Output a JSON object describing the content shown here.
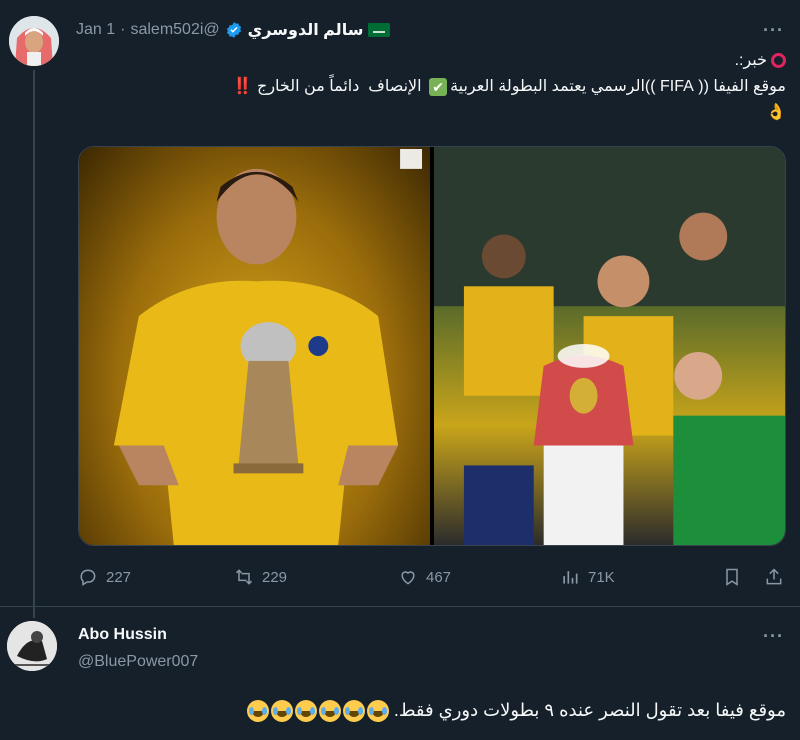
{
  "tweet": {
    "author_name": "سالم الدوسري",
    "handle": "@salem502i",
    "separator": "·",
    "date": "Jan 1",
    "more_label": "···",
    "text_line1": "خبر:.",
    "text_line2": "موقع الفيفا (( FIFA ))الرسمي يعتمد البطولة العربية",
    "text_line2_tail": " الإنصاف  دائماً من الخارج ",
    "bang": "‼️",
    "ok_hand": "👌",
    "media_alt": [
      "",
      ""
    ],
    "stats": {
      "replies": "227",
      "retweets": "229",
      "likes": "467",
      "views": "71K"
    }
  },
  "reply": {
    "author_name": "Abo Hussin",
    "handle": "@BluePower007",
    "more_label": "···",
    "text": "موقع فيفا بعد تقول النصر عنده ٩ بطولات دوري فقط."
  },
  "colors": {
    "background": "#15202b",
    "text": "#f7f9f9",
    "secondary": "#8b98a5",
    "verified": "#1d9bf0",
    "divider": "#38444d"
  }
}
